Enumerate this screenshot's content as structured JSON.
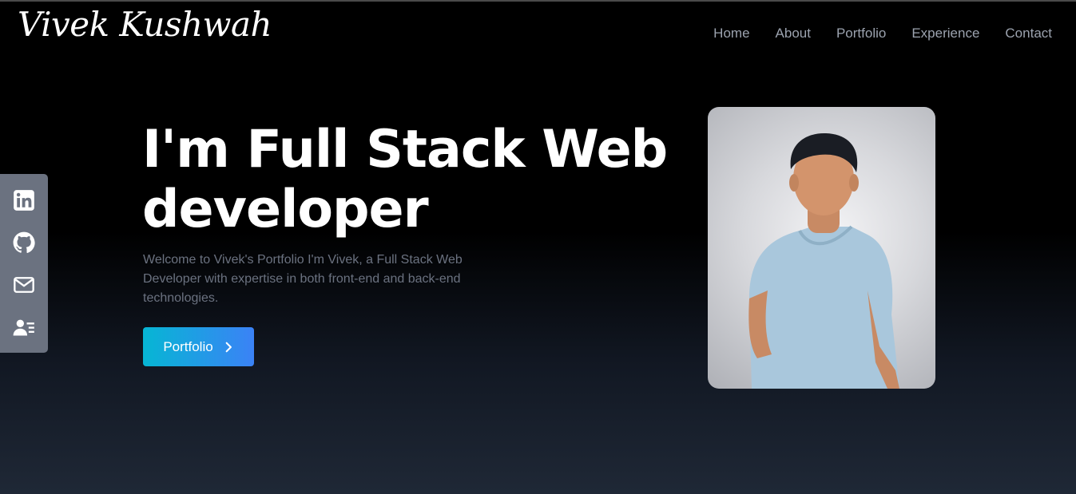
{
  "header": {
    "logo": "Vivek Kushwah",
    "nav": [
      "Home",
      "About",
      "Portfolio",
      "Experience",
      "Contact"
    ]
  },
  "social": {
    "icons": [
      "linkedin-icon",
      "github-icon",
      "mail-icon",
      "contact-card-icon"
    ]
  },
  "hero": {
    "title": "I'm Full Stack Web developer",
    "description": "Welcome to Vivek's Portfolio I'm Vivek, a Full Stack Web Developer with expertise in both front-end and back-end technologies.",
    "cta_label": "Portfolio"
  },
  "colors": {
    "accent_start": "#06b6d4",
    "accent_end": "#3b82f6",
    "sidebar": "#6b7280",
    "nav_text": "#9ca3af"
  }
}
